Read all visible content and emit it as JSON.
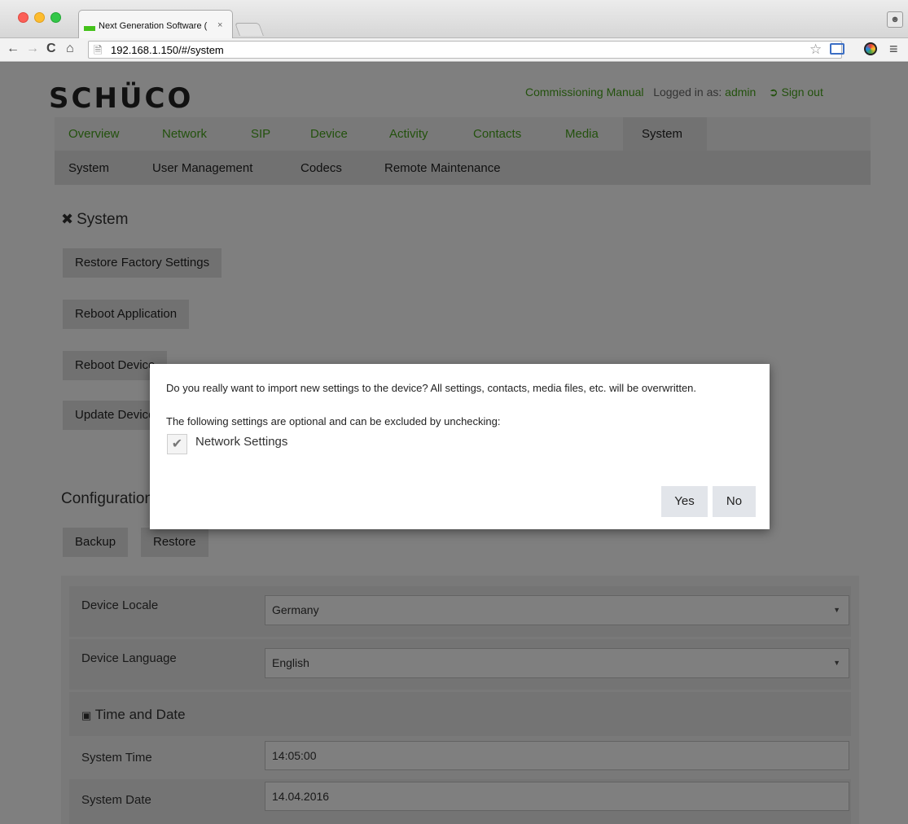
{
  "browser": {
    "tab_title": "Next Generation Software (",
    "tab_close": "×",
    "url": "192.168.1.150/#/system"
  },
  "header": {
    "logo": "SCHÜCO",
    "manual_link": "Commissioning Manual",
    "logged_in_prefix": "Logged in as:",
    "username": "admin",
    "sign_out": "Sign out"
  },
  "main_nav": {
    "items": [
      "Overview",
      "Network",
      "SIP",
      "Device",
      "Activity",
      "Contacts",
      "Media",
      "System"
    ],
    "active": "System"
  },
  "sub_nav": {
    "items": [
      "System",
      "User Management",
      "Codecs",
      "Remote Maintenance"
    ]
  },
  "system_section": {
    "title": "System",
    "buttons": [
      "Restore Factory Settings",
      "Reboot Application",
      "Reboot Device",
      "Update Device"
    ]
  },
  "configuration_section": {
    "title": "Configuration",
    "buttons": [
      "Backup",
      "Restore"
    ]
  },
  "settings": {
    "device_locale_label": "Device Locale",
    "device_locale_value": "Germany",
    "device_language_label": "Device Language",
    "device_language_value": "English",
    "time_and_date_heading": "Time and Date",
    "system_time_label": "System Time",
    "system_time_value": "14:05:00",
    "system_date_label": "System Date",
    "system_date_value": "14.04.2016"
  },
  "modal": {
    "message": "Do you really want to import new settings to the device? All settings, contacts, media files, etc. will be overwritten.",
    "optional_text": "The following settings are optional and can be excluded by unchecking:",
    "checkbox_label": "Network Settings",
    "checkbox_checked": true,
    "yes_label": "Yes",
    "no_label": "No"
  },
  "colors": {
    "accent_green": "#46a31b",
    "overlay": "rgba(0,0,0,0.5)"
  }
}
